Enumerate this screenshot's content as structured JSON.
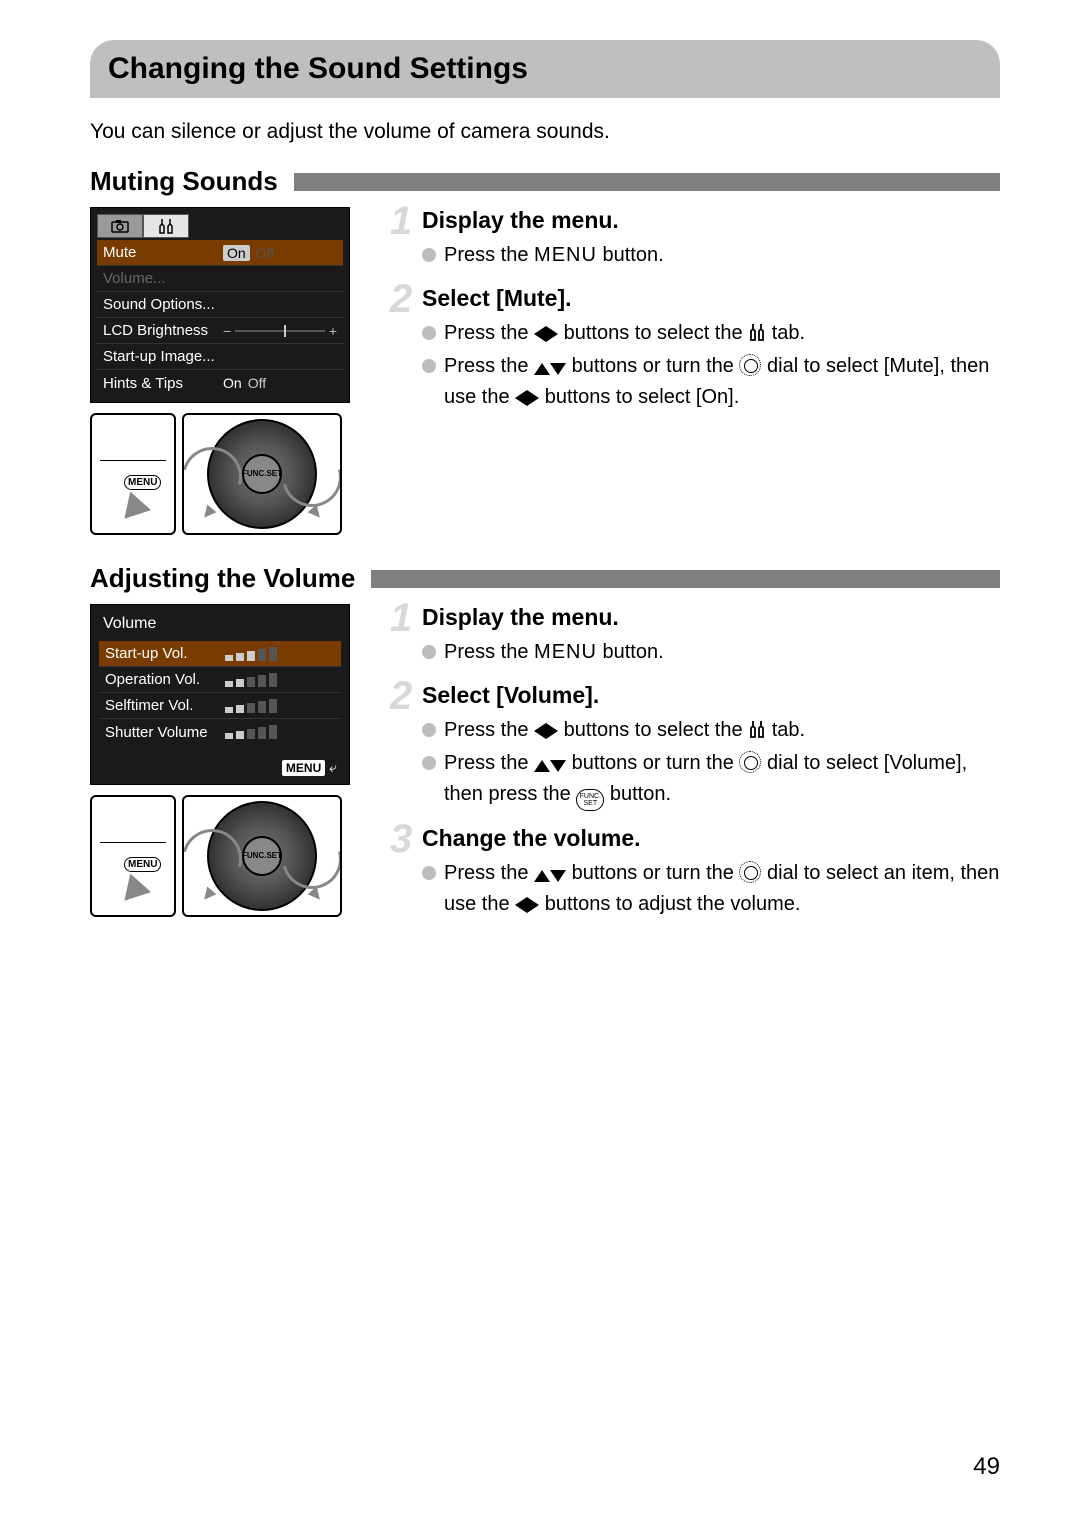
{
  "title": "Changing the Sound Settings",
  "intro": "You can silence or adjust the volume of camera sounds.",
  "page_number": "49",
  "section1": {
    "heading": "Muting Sounds",
    "lcd": {
      "tab_camera": "◻",
      "tab_tools": "⟂",
      "rows": [
        {
          "label": "Mute",
          "on": "On",
          "off": "Off",
          "selected": true
        },
        {
          "label": "Volume...",
          "dim": true
        },
        {
          "label": "Sound Options..."
        },
        {
          "label": "LCD Brightness",
          "slider_pos": 0.55
        },
        {
          "label": "Start-up Image..."
        },
        {
          "label": "Hints & Tips",
          "on": "On",
          "off": "Off"
        }
      ]
    },
    "steps": [
      {
        "num": "1",
        "title": "Display the menu.",
        "bullets": [
          {
            "pre": "Press the ",
            "after_menu": " button."
          }
        ]
      },
      {
        "num": "2",
        "title": "Select [Mute].",
        "bullets": [
          {
            "pre": "Press the ",
            "icon": "lr",
            "mid": " buttons to select the ",
            "icon2": "tools",
            "end": " tab."
          },
          {
            "pre": "Press the ",
            "icon": "ud",
            "mid": " buttons or turn the ",
            "icon2": "ring",
            "end": " dial to select [Mute], then use the ",
            "icon3": "lr",
            "end2": " buttons to select [On]."
          }
        ]
      }
    ]
  },
  "section2": {
    "heading": "Adjusting the Volume",
    "lcd": {
      "title": "Volume",
      "rows": [
        {
          "label": "Start-up Vol.",
          "level": 3,
          "selected": true
        },
        {
          "label": "Operation Vol.",
          "level": 2
        },
        {
          "label": "Selftimer Vol.",
          "level": 2
        },
        {
          "label": "Shutter Volume",
          "level": 2
        }
      ],
      "back": "MENU"
    },
    "steps": [
      {
        "num": "1",
        "title": "Display the menu.",
        "bullets": [
          {
            "pre": "Press the ",
            "after_menu": " button."
          }
        ]
      },
      {
        "num": "2",
        "title": "Select [Volume].",
        "bullets": [
          {
            "pre": "Press the ",
            "icon": "lr",
            "mid": " buttons to select the ",
            "icon2": "tools",
            "end": " tab."
          },
          {
            "pre": "Press the ",
            "icon": "ud",
            "mid": " buttons or turn the ",
            "icon2": "ring",
            "end": " dial to select [Volume], then press the ",
            "icon3": "func",
            "end2": " button."
          }
        ]
      },
      {
        "num": "3",
        "title": "Change the volume.",
        "bullets": [
          {
            "pre": "Press the ",
            "icon": "ud",
            "mid": " buttons or turn the ",
            "icon2": "ring",
            "end": " dial to select an item, then use the ",
            "icon3": "lr",
            "end2": " buttons to adjust the volume."
          }
        ]
      }
    ]
  },
  "icons": {
    "menu_text": "MENU",
    "func_a": "FUNC.",
    "func_b": "SET"
  }
}
